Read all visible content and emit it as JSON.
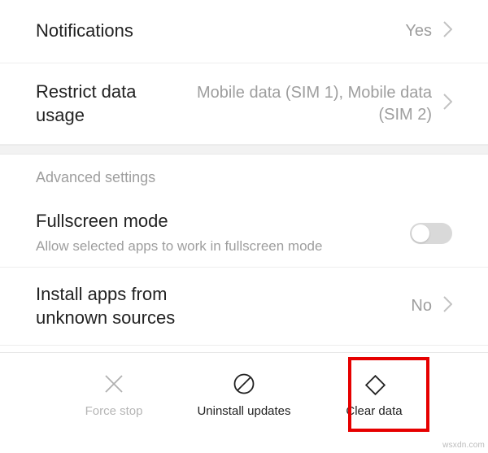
{
  "rows": {
    "notifications": {
      "label": "Notifications",
      "value": "Yes"
    },
    "restrict": {
      "label": "Restrict data usage",
      "value": "Mobile data (SIM 1), Mobile data (SIM 2)"
    },
    "fullscreen": {
      "label": "Fullscreen mode",
      "subtitle": "Allow selected apps to work in fullscreen mode"
    },
    "install": {
      "label": "Install apps from unknown sources",
      "value": "No"
    }
  },
  "section": {
    "advanced": "Advanced settings"
  },
  "actions": {
    "force_stop": "Force stop",
    "uninstall": "Uninstall updates",
    "clear": "Clear data"
  },
  "credit": "wsxdn.com"
}
